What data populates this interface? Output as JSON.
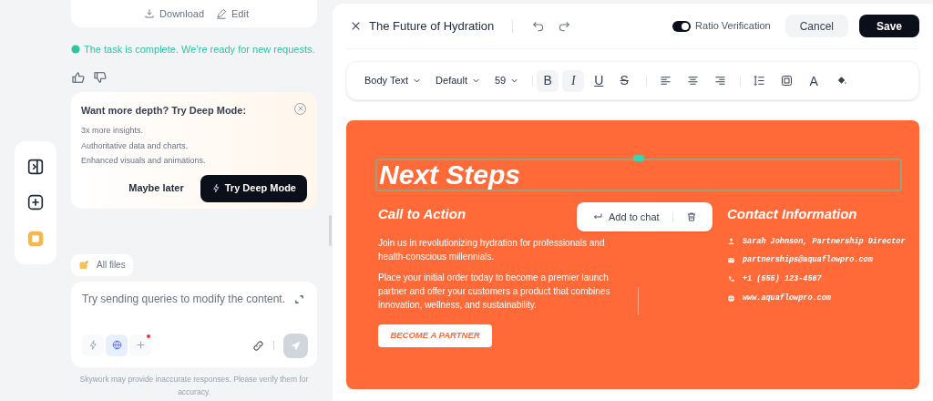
{
  "chat": {
    "file_actions": [
      {
        "kind": "download",
        "label": "Download"
      },
      {
        "kind": "edit",
        "label": "Edit"
      }
    ],
    "status": "The task is complete. We’re ready for new requests.",
    "deep_mode": {
      "title": "Want more depth? Try Deep Mode:",
      "points": [
        "3x more insights.",
        "Authoritative data and charts.",
        "Enhanced visuals and animations."
      ],
      "secondary": "Maybe later",
      "primary": "Try Deep Mode"
    },
    "files_chip": "All files",
    "input": {
      "placeholder": "Try sending queries to modify the content."
    },
    "input_tools": [
      {
        "kind": "spark",
        "selected": false
      },
      {
        "kind": "globe",
        "selected": true
      },
      {
        "kind": "plus",
        "selected": false
      }
    ],
    "disclaimer": "Skywork may provide inaccurate responses. Please verify them for accuracy."
  },
  "side_rail": [
    {
      "kind": "panel"
    },
    {
      "kind": "add"
    },
    {
      "kind": "app"
    }
  ],
  "editor": {
    "title": "The Future of Hydration",
    "ratio_verification": {
      "label": "Ratio Verification",
      "on": true
    },
    "cancel": "Cancel",
    "save": "Save",
    "toolbar": {
      "dropdowns": [
        "Body Text",
        "Default",
        "59"
      ],
      "formats": [
        {
          "kind": "bold",
          "label": "B",
          "active": true
        },
        {
          "kind": "italic",
          "label": "I",
          "active": true
        },
        {
          "kind": "underline",
          "label": "U",
          "active": false
        },
        {
          "kind": "strike",
          "label": "S",
          "active": false
        }
      ],
      "tools": [
        {
          "kind": "align-left"
        },
        {
          "kind": "align-center"
        },
        {
          "kind": "align-right"
        },
        {
          "kind": "line-height"
        },
        {
          "kind": "frame"
        },
        {
          "kind": "font-color",
          "label": "A"
        },
        {
          "kind": "fill"
        }
      ]
    },
    "slide": {
      "title": "Next Steps",
      "left_heading": "Call to Action",
      "paragraphs": [
        "Join us in revolutionizing hydration for professionals and health-conscious millennials.",
        "Place your initial order today to become a premier launch partner and offer your customers a product that combines innovation, wellness, and sustainability."
      ],
      "cta": "BECOME A PARTNER",
      "right_heading": "Contact Information",
      "contacts": [
        {
          "kind": "person",
          "text": "Sarah Johnson, Partnership Director"
        },
        {
          "kind": "mail",
          "text": "partnerships@aquaflowpro.com"
        },
        {
          "kind": "phone",
          "text": "+1 (555) 123-4567"
        },
        {
          "kind": "web",
          "text": "www.aquaflowpro.com"
        }
      ],
      "popup": {
        "label": "Add to chat"
      }
    }
  }
}
